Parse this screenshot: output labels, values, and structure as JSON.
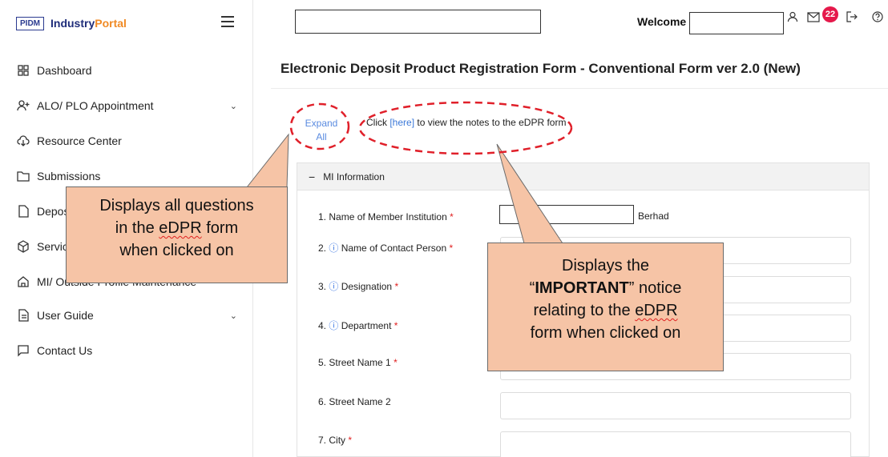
{
  "brand": {
    "logo": "PIDM",
    "name_part1": "Industry",
    "name_part2": "Portal"
  },
  "sidebar": {
    "items": [
      {
        "label": "Dashboard",
        "icon": "grid-icon"
      },
      {
        "label": "ALO/ PLO Appointment",
        "icon": "user-plus-icon",
        "expandable": true
      },
      {
        "label": "Resource Center",
        "icon": "cloud-download-icon"
      },
      {
        "label": "Submissions",
        "icon": "folder-icon"
      },
      {
        "label": "Deposit",
        "icon": "file-icon"
      },
      {
        "label": "Services",
        "icon": "cube-icon"
      },
      {
        "label": "MI/ Outside Profile Maintenance",
        "icon": "home-icon"
      },
      {
        "label": "User Guide",
        "icon": "document-icon",
        "expandable": true
      },
      {
        "label": "Contact Us",
        "icon": "chat-icon"
      }
    ]
  },
  "header": {
    "welcome": "Welcome",
    "notification_count": "22"
  },
  "main": {
    "title": "Electronic Deposit Product Registration Form - Conventional Form ver 2.0 (New)",
    "expand_line1": "Expand",
    "expand_line2": "All",
    "notes_prefix": "Click ",
    "notes_link": "[here]",
    "notes_suffix": " to view the notes to the eDPR form",
    "section_title": "MI Information",
    "berhad": "Berhad",
    "fields": [
      {
        "num": "1.",
        "label": "Name of Member Institution",
        "required": true,
        "info": false
      },
      {
        "num": "2.",
        "label": "Name of Contact Person",
        "required": true,
        "info": true
      },
      {
        "num": "3.",
        "label": "Designation",
        "required": true,
        "info": true
      },
      {
        "num": "4.",
        "label": "Department",
        "required": true,
        "info": true
      },
      {
        "num": "5.",
        "label": "Street Name 1",
        "required": true,
        "info": false
      },
      {
        "num": "6.",
        "label": "Street Name 2",
        "required": false,
        "info": false
      },
      {
        "num": "7.",
        "label": "City",
        "required": true,
        "info": false
      }
    ],
    "required_mark": "*",
    "info_mark": "ⓘ"
  },
  "callouts": {
    "left": {
      "l1": "Displays all questions",
      "l2a": "in the ",
      "l2b": "eDPR",
      "l2c": " form",
      "l3": "when clicked on"
    },
    "right": {
      "l1": "Displays the",
      "l2a": "“",
      "l2b": "IMPORTANT",
      "l2c": "” notice",
      "l3a": "relating to the ",
      "l3b": "eDPR",
      "l4": "form when clicked on"
    }
  },
  "colors": {
    "callout_fill": "#f6c4a6",
    "ellipse_stroke": "#e0202a",
    "badge": "#e5194b",
    "link": "#3b78d8"
  }
}
